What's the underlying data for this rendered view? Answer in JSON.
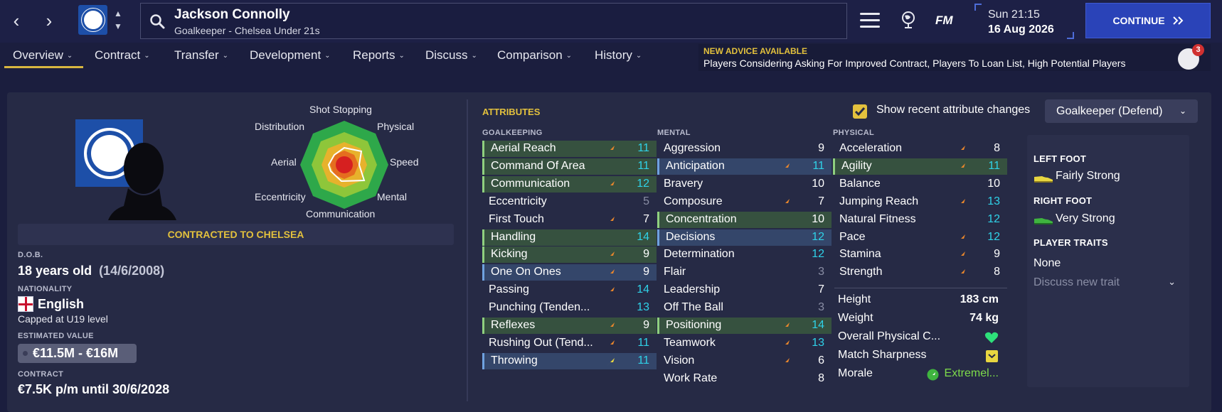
{
  "topbar": {
    "player_name": "Jackson Connolly",
    "player_sub": "Goalkeeper - Chelsea Under 21s",
    "fm_logo": "FM",
    "time": "Sun 21:15",
    "date": "16 Aug 2026",
    "continue_label": "CONTINUE"
  },
  "tabs": [
    "Overview",
    "Contract",
    "Transfer",
    "Development",
    "Reports",
    "Discuss",
    "Comparison",
    "History"
  ],
  "advice": {
    "title": "NEW ADVICE AVAILABLE",
    "text": "Players Considering Asking For Improved Contract, Players To Loan List, High Potential Players",
    "badge_count": "3"
  },
  "radar": {
    "labels": [
      "Shot Stopping",
      "Physical",
      "Speed",
      "Mental",
      "Communication",
      "Eccentricity",
      "Aerial",
      "Distribution"
    ]
  },
  "profile": {
    "contracted": "CONTRACTED TO CHELSEA",
    "dob_label": "D.O.B.",
    "age": "18 years old",
    "dob": "(14/6/2008)",
    "nationality_label": "NATIONALITY",
    "nationality": "English",
    "caps": "Capped at U19 level",
    "value_label": "ESTIMATED VALUE",
    "value": "€11.5M - €16M",
    "contract_label": "CONTRACT",
    "contract": "€7.5K p/m until 30/6/2028"
  },
  "attributes": {
    "heading": "ATTRIBUTES",
    "show_changes": "Show recent attribute changes",
    "role": "Goalkeeper (Defend)",
    "goalkeeping_heading": "GOALKEEPING",
    "mental_heading": "MENTAL",
    "physical_heading": "PHYSICAL",
    "goalkeeping": [
      {
        "name": "Aerial Reach",
        "value": "11"
      },
      {
        "name": "Command Of Area",
        "value": "11"
      },
      {
        "name": "Communication",
        "value": "12"
      },
      {
        "name": "Eccentricity",
        "value": "5"
      },
      {
        "name": "First Touch",
        "value": "7"
      },
      {
        "name": "Handling",
        "value": "14"
      },
      {
        "name": "Kicking",
        "value": "9"
      },
      {
        "name": "One On Ones",
        "value": "9"
      },
      {
        "name": "Passing",
        "value": "14"
      },
      {
        "name": "Punching (Tenden...",
        "value": "13"
      },
      {
        "name": "Reflexes",
        "value": "9"
      },
      {
        "name": "Rushing Out (Tend...",
        "value": "11"
      },
      {
        "name": "Throwing",
        "value": "11"
      }
    ],
    "mental": [
      {
        "name": "Aggression",
        "value": "9"
      },
      {
        "name": "Anticipation",
        "value": "11"
      },
      {
        "name": "Bravery",
        "value": "10"
      },
      {
        "name": "Composure",
        "value": "7"
      },
      {
        "name": "Concentration",
        "value": "10"
      },
      {
        "name": "Decisions",
        "value": "12"
      },
      {
        "name": "Determination",
        "value": "12"
      },
      {
        "name": "Flair",
        "value": "3"
      },
      {
        "name": "Leadership",
        "value": "7"
      },
      {
        "name": "Off The Ball",
        "value": "3"
      },
      {
        "name": "Positioning",
        "value": "14"
      },
      {
        "name": "Teamwork",
        "value": "13"
      },
      {
        "name": "Vision",
        "value": "6"
      },
      {
        "name": "Work Rate",
        "value": "8"
      }
    ],
    "physical": [
      {
        "name": "Acceleration",
        "value": "8"
      },
      {
        "name": "Agility",
        "value": "11"
      },
      {
        "name": "Balance",
        "value": "10"
      },
      {
        "name": "Jumping Reach",
        "value": "13"
      },
      {
        "name": "Natural Fitness",
        "value": "12"
      },
      {
        "name": "Pace",
        "value": "12"
      },
      {
        "name": "Stamina",
        "value": "9"
      },
      {
        "name": "Strength",
        "value": "8"
      }
    ],
    "extra": {
      "height_label": "Height",
      "height": "183 cm",
      "weight_label": "Weight",
      "weight": "74 kg",
      "overall_label": "Overall Physical C...",
      "sharpness_label": "Match Sharpness",
      "morale_label": "Morale",
      "morale": "Extremel..."
    }
  },
  "sidebar": {
    "left_foot_label": "LEFT FOOT",
    "left_foot": "Fairly Strong",
    "right_foot_label": "RIGHT FOOT",
    "right_foot": "Very Strong",
    "traits_label": "PLAYER TRAITS",
    "traits": "None",
    "discuss_trait": "Discuss new trait"
  },
  "colors": {
    "accent_gold": "#e3c13d",
    "cyan_value": "#2fd2e8",
    "continue_blue": "#2a43b8",
    "green_row": "#36513f",
    "blue_row": "#34466a"
  }
}
